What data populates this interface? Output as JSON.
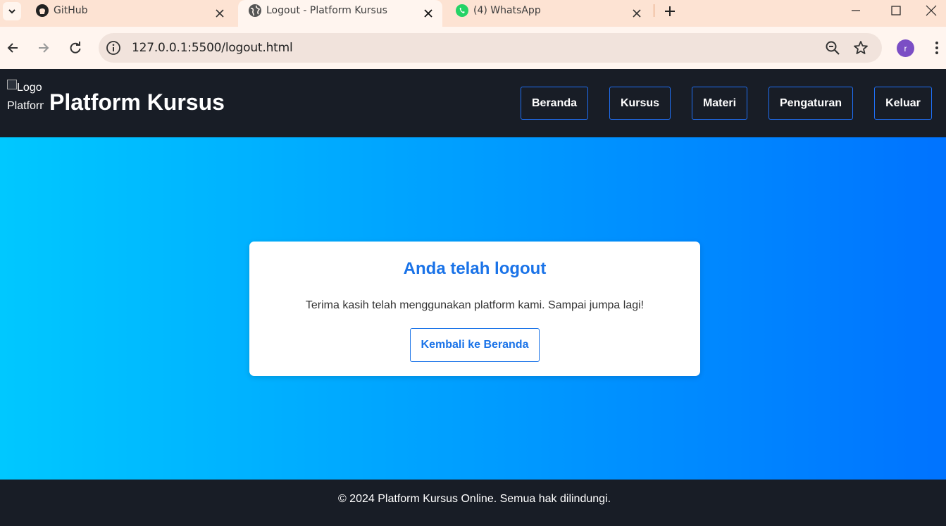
{
  "browser": {
    "tabs": [
      {
        "title": "GitHub",
        "icon": "github-icon",
        "active": false
      },
      {
        "title": "Logout - Platform Kursus",
        "icon": "globe-icon",
        "active": true
      },
      {
        "title": "(4) WhatsApp",
        "icon": "whatsapp-icon",
        "active": false
      }
    ],
    "url": "127.0.0.1:5500/logout.html",
    "profile_initial": "r",
    "colors": {
      "tabstrip": "#fde3d3",
      "toolbar": "#fff5ef",
      "omnibox": "#f1e3dc",
      "profile": "#7b4ec5"
    }
  },
  "site": {
    "logo_alt": "Logo Platform",
    "brand": "Platform Kursus",
    "nav": [
      {
        "label": "Beranda"
      },
      {
        "label": "Kursus"
      },
      {
        "label": "Materi"
      },
      {
        "label": "Pengaturan"
      },
      {
        "label": "Keluar"
      }
    ],
    "colors": {
      "header_bg": "#181d26",
      "accent": "#1a73e8",
      "gradient_start": "#00c8ff",
      "gradient_end": "#0073ff"
    }
  },
  "card": {
    "title": "Anda telah logout",
    "message": "Terima kasih telah menggunakan platform kami. Sampai jumpa lagi!",
    "button_label": "Kembali ke Beranda"
  },
  "footer": {
    "text": "© 2024 Platform Kursus Online. Semua hak dilindungi."
  }
}
